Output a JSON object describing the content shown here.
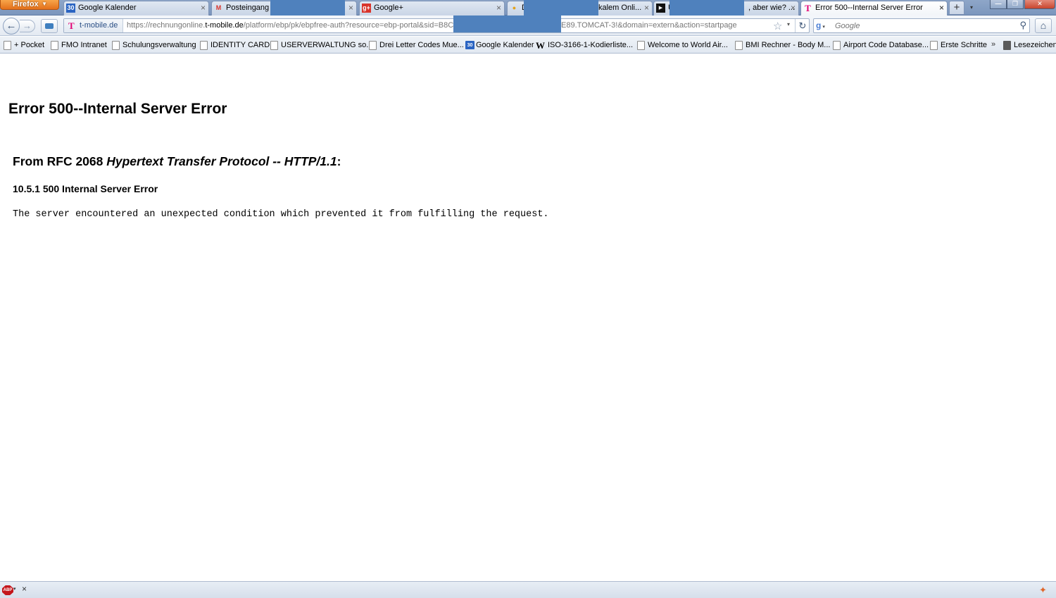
{
  "window": {
    "app_menu_label": "Firefox",
    "min_glyph": "—",
    "max_glyph": "❐",
    "close_glyph": "✕"
  },
  "tabs": [
    {
      "title": "Google Kalender",
      "favicon": "google-calendar-icon",
      "favicon_text": "30"
    },
    {
      "title": "Posteingang -",
      "favicon": "gmail-icon",
      "favicon_text": "M"
    },
    {
      "title": "Google+",
      "favicon": "google-plus-icon",
      "favicon_text": "g+"
    },
    {
      "title": "D",
      "title_tail": "kalem Onli...",
      "favicon": "page-icon",
      "favicon_text": "●"
    },
    {
      "title": "U",
      "title_tail": ", aber wie? ...",
      "favicon": "youtube-icon",
      "favicon_text": "▶"
    },
    {
      "title": "Error 500--Internal Server Error",
      "favicon": "t-mobile-icon",
      "favicon_text": "T",
      "selected": true
    }
  ],
  "tab_close_glyph": "×",
  "new_tab_glyph": "+",
  "all_tabs_glyph": "▾",
  "nav": {
    "back_glyph": "←",
    "forward_glyph": "→",
    "identity_label": "t-mobile.de",
    "identity_logo": "T",
    "url_prefix": "https://rechnungonline.",
    "url_domain": "t-mobile.de",
    "url_path": "/platform/ebp/pk/ebpfree-auth?resource=ebp-portal&sid=B8C",
    "url_tail": "E89.TOMCAT-3!&domain=extern&action=startpage",
    "star_glyph": "☆",
    "urldrop_glyph": "▾",
    "reload_glyph": "↻",
    "search_placeholder": "Google",
    "search_engine_glyph": "g",
    "search_engine_drop": "▾",
    "search_go_glyph": "⚲",
    "home_glyph": "⌂"
  },
  "bookmarks": [
    {
      "label": "+ Pocket",
      "icon": "page-icon"
    },
    {
      "label": "FMO Intranet",
      "icon": "page-icon"
    },
    {
      "label": "Schulungsverwaltung",
      "icon": "page-icon"
    },
    {
      "label": "IDENTITY CARD",
      "icon": "page-icon"
    },
    {
      "label": "USERVERWALTUNG so...",
      "icon": "page-icon"
    },
    {
      "label": "Drei Letter Codes Mue...",
      "icon": "page-icon"
    },
    {
      "label": "Google Kalender",
      "icon": "google-calendar-icon",
      "icon_text": "30"
    },
    {
      "label": "ISO-3166-1-Kodierliste...",
      "icon": "wikipedia-icon",
      "icon_text": "W"
    },
    {
      "label": "Welcome to World Air...",
      "icon": "page-icon"
    },
    {
      "label": "BMI Rechner - Body M...",
      "icon": "page-icon"
    },
    {
      "label": "Airport Code Database...",
      "icon": "page-icon"
    },
    {
      "label": "Erste Schritte",
      "icon": "page-icon"
    },
    {
      "label": "Lesezeichen",
      "icon": "bookmarks-menu-icon"
    }
  ],
  "bookmarks_overflow_glyph": "»",
  "page": {
    "title": "Error 500--Internal Server Error",
    "rfc_prefix": "From RFC 2068 ",
    "rfc_italic": "Hypertext Transfer Protocol -- HTTP/1.1",
    "rfc_suffix": ":",
    "subheading": "10.5.1 500 Internal Server Error",
    "message": "The server encountered an unexpected condition which prevented it from fulfilling the request."
  },
  "addonbar": {
    "abp_label": "ABP",
    "abp_drop": "▾",
    "close_glyph": "×",
    "right_icon_glyph": "✦"
  },
  "colors": {
    "redaction": "#4f81bd",
    "tmobile_magenta": "#e20074",
    "firefox_orange": "#e4711b"
  }
}
